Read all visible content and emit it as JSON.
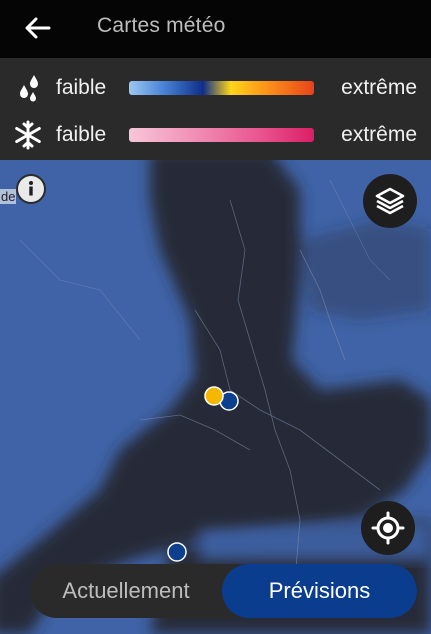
{
  "header": {
    "title": "Cartes météo",
    "back_icon": "arrow-left-icon"
  },
  "legend": {
    "rain": {
      "icon": "raindrops-icon",
      "low_label": "faible",
      "high_label": "extrême"
    },
    "snow": {
      "icon": "snowflake-icon",
      "low_label": "faible",
      "high_label": "extrême"
    }
  },
  "map": {
    "edge_label": "de",
    "info_icon": "info-icon",
    "layers_icon": "layers-icon",
    "locate_icon": "crosshair-icon"
  },
  "mode_toggle": {
    "now_label": "Actuellement",
    "forecast_label": "Prévisions",
    "selected": "forecast"
  },
  "colors": {
    "accent": "#0b3d8f",
    "precip_light": "#3f63a6",
    "dry_area": "#252a38",
    "marker_yellow": "#f5b800",
    "marker_blue": "#0d3f8f"
  }
}
